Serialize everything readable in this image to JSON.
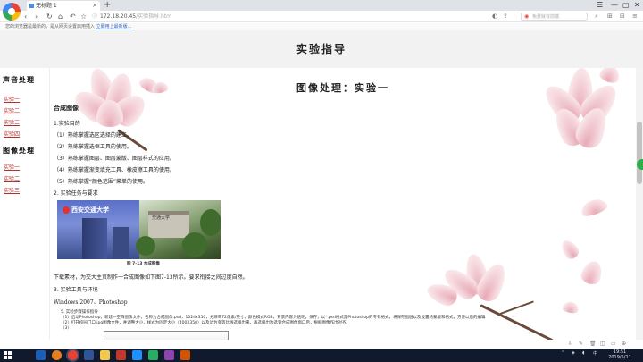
{
  "browser": {
    "tab_title": "无标题 1",
    "url_host": "172.18.20.45",
    "url_path": "/实验指导.htm",
    "search_placeholder": "免费就有前端",
    "info_text": "您的浏览器是最新的，是从网页设置启用插入",
    "info_link": "立即用上最新版…"
  },
  "page": {
    "title": "实验指导"
  },
  "sidebar": {
    "heading_sound": "声音处理",
    "sound_links": [
      "实验一",
      "实验二",
      "实验三",
      "实验四"
    ],
    "heading_image": "图像处理",
    "image_links": [
      "实验一",
      "实验二",
      "实验三"
    ]
  },
  "content": {
    "title": "图像处理：实验一",
    "section": "合成图像",
    "goal_heading": "1.实验目的",
    "goals": [
      "（1）熟练掌握选区选择的建立。",
      "（2）熟练掌握选框工具的使用。",
      "（3）熟练掌握图层、图层蒙版、图层样式的应用。",
      "（4）熟练掌握渐变填充工具、橡皮擦工具的使用。",
      "（5）熟练掌握“颜色范围”菜单的使用。"
    ],
    "task_heading": "2. 实验任务与要求",
    "figure_logo": "西安交通大学",
    "figure_sign": "交通大学",
    "figure_caption": "图 7-13 合成图像",
    "task_text": "下载素材，为交大主页制作一合成图像如下图7-13所示。要求衔接之间过度自然。",
    "tools_heading": "3. 实验工具与环境",
    "env": "Windows 2007、Photoshop",
    "steps_heading": "5. 实验步骤操作指导",
    "step1": "（1）启动Photoshop，新建一空白图像文件，名称为合成图像.psd，1024x350，分辨率72像素/英寸，颜色模式RGB，背景内容为透明，保存，以*.psd格式是Photoshop的专有格式，将保存图层以及设置的蒙版和格式，方便以后的编辑",
    "step2": "（2）打开校园门口.jpg图像文件，并调整大小，样式为固定大小（400X350）以及边为变等比线选择出来，再选择出边选到合成图像窗口后，根据图像作出对齐。",
    "step3": "（3）"
  },
  "taskbar": {
    "time": "19:51",
    "date": "2019/5/11"
  }
}
